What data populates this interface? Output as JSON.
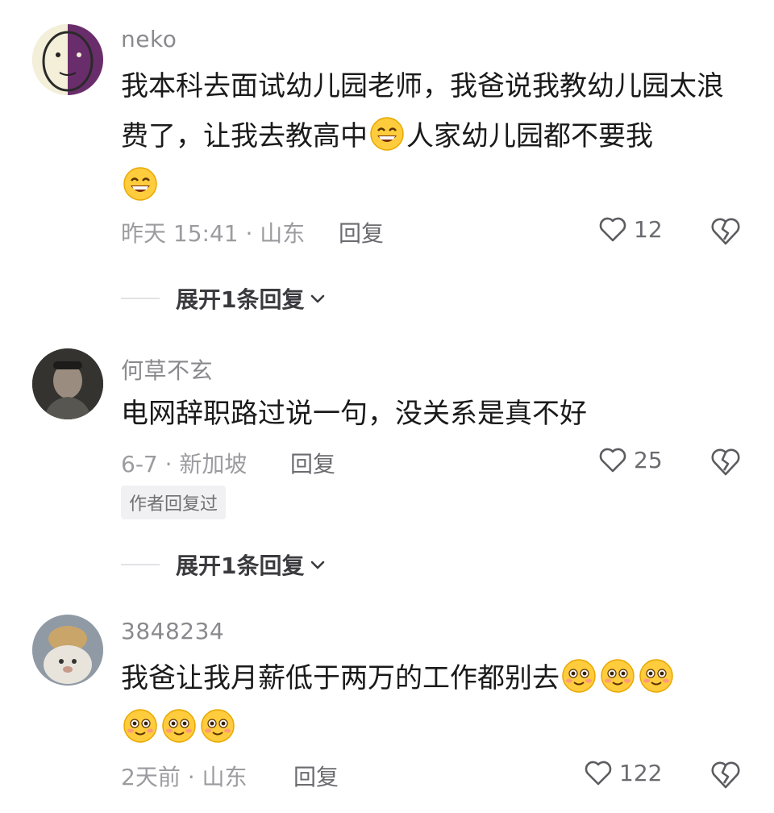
{
  "comments": [
    {
      "username": "neko",
      "text_parts": [
        "我本科去面试幼儿园老师，我爸说我教幼儿园太浪费了，让我去教高中",
        "人家幼儿园都不要我"
      ],
      "time_location": "昨天 15:41 · 山东",
      "reply_label": "回复",
      "likes": "12",
      "expand_label": "展开1条回复"
    },
    {
      "username": "何草不玄",
      "text": "电网辞职路过说一句，没关系是真不好",
      "time_location": "6-7 · 新加坡",
      "reply_label": "回复",
      "likes": "25",
      "badge": "作者回复过",
      "expand_label": "展开1条回复"
    },
    {
      "username": "3848234",
      "text": "我爸让我月薪低于两万的工作都别去",
      "time_location": "2天前 · 山东",
      "reply_label": "回复",
      "likes": "122"
    }
  ],
  "icons": {
    "like": "heart-outline-icon",
    "dislike": "broken-heart-icon",
    "expand": "chevron-down-icon",
    "emoji_grin": "grin-emoji-icon",
    "emoji_blush": "blushing-emoji-icon"
  }
}
